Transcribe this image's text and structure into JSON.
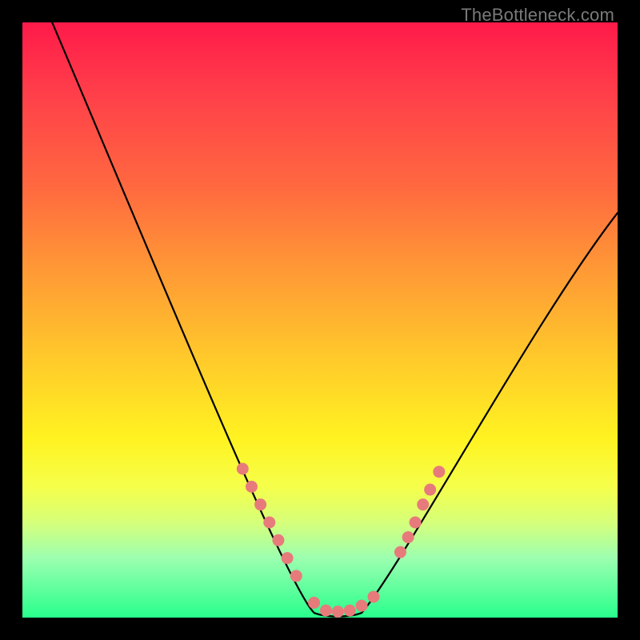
{
  "watermark": "TheBottleneck.com",
  "chart_data": {
    "type": "line",
    "title": "",
    "xlabel": "",
    "ylabel": "",
    "xlim": [
      0,
      100
    ],
    "ylim": [
      0,
      100
    ],
    "series": [
      {
        "name": "bottleneck-curve",
        "x": [
          5,
          10,
          15,
          20,
          25,
          30,
          35,
          40,
          45,
          50,
          55,
          60,
          65,
          70,
          75,
          80,
          85,
          90,
          95,
          100
        ],
        "values": [
          100,
          89,
          78,
          66,
          55,
          44,
          32,
          21,
          10,
          2,
          0,
          2,
          9,
          16,
          24,
          33,
          42,
          51,
          60,
          68
        ]
      }
    ],
    "markers": {
      "name": "highlighted-points",
      "color": "#e77b7b",
      "points": [
        {
          "x": 37,
          "y": 25
        },
        {
          "x": 38.5,
          "y": 22
        },
        {
          "x": 40,
          "y": 19
        },
        {
          "x": 41.5,
          "y": 16
        },
        {
          "x": 43,
          "y": 13
        },
        {
          "x": 44.5,
          "y": 10
        },
        {
          "x": 46,
          "y": 7
        },
        {
          "x": 49,
          "y": 2.5
        },
        {
          "x": 51,
          "y": 1.2
        },
        {
          "x": 53,
          "y": 1.0
        },
        {
          "x": 55,
          "y": 1.2
        },
        {
          "x": 57,
          "y": 2.0
        },
        {
          "x": 59,
          "y": 3.5
        },
        {
          "x": 63.5,
          "y": 11
        },
        {
          "x": 64.8,
          "y": 13.5
        },
        {
          "x": 66,
          "y": 16
        },
        {
          "x": 67.3,
          "y": 19
        },
        {
          "x": 68.5,
          "y": 21.5
        },
        {
          "x": 70,
          "y": 24.5
        }
      ]
    },
    "gradient_stops": [
      {
        "pos": 0,
        "color": "#ff1a4a"
      },
      {
        "pos": 12,
        "color": "#ff3f4a"
      },
      {
        "pos": 28,
        "color": "#ff6a3f"
      },
      {
        "pos": 42,
        "color": "#ff9a35"
      },
      {
        "pos": 56,
        "color": "#ffc82b"
      },
      {
        "pos": 70,
        "color": "#fff321"
      },
      {
        "pos": 78,
        "color": "#f5ff4a"
      },
      {
        "pos": 84,
        "color": "#d6ff7a"
      },
      {
        "pos": 90,
        "color": "#9cffb0"
      },
      {
        "pos": 100,
        "color": "#28ff8c"
      }
    ]
  }
}
